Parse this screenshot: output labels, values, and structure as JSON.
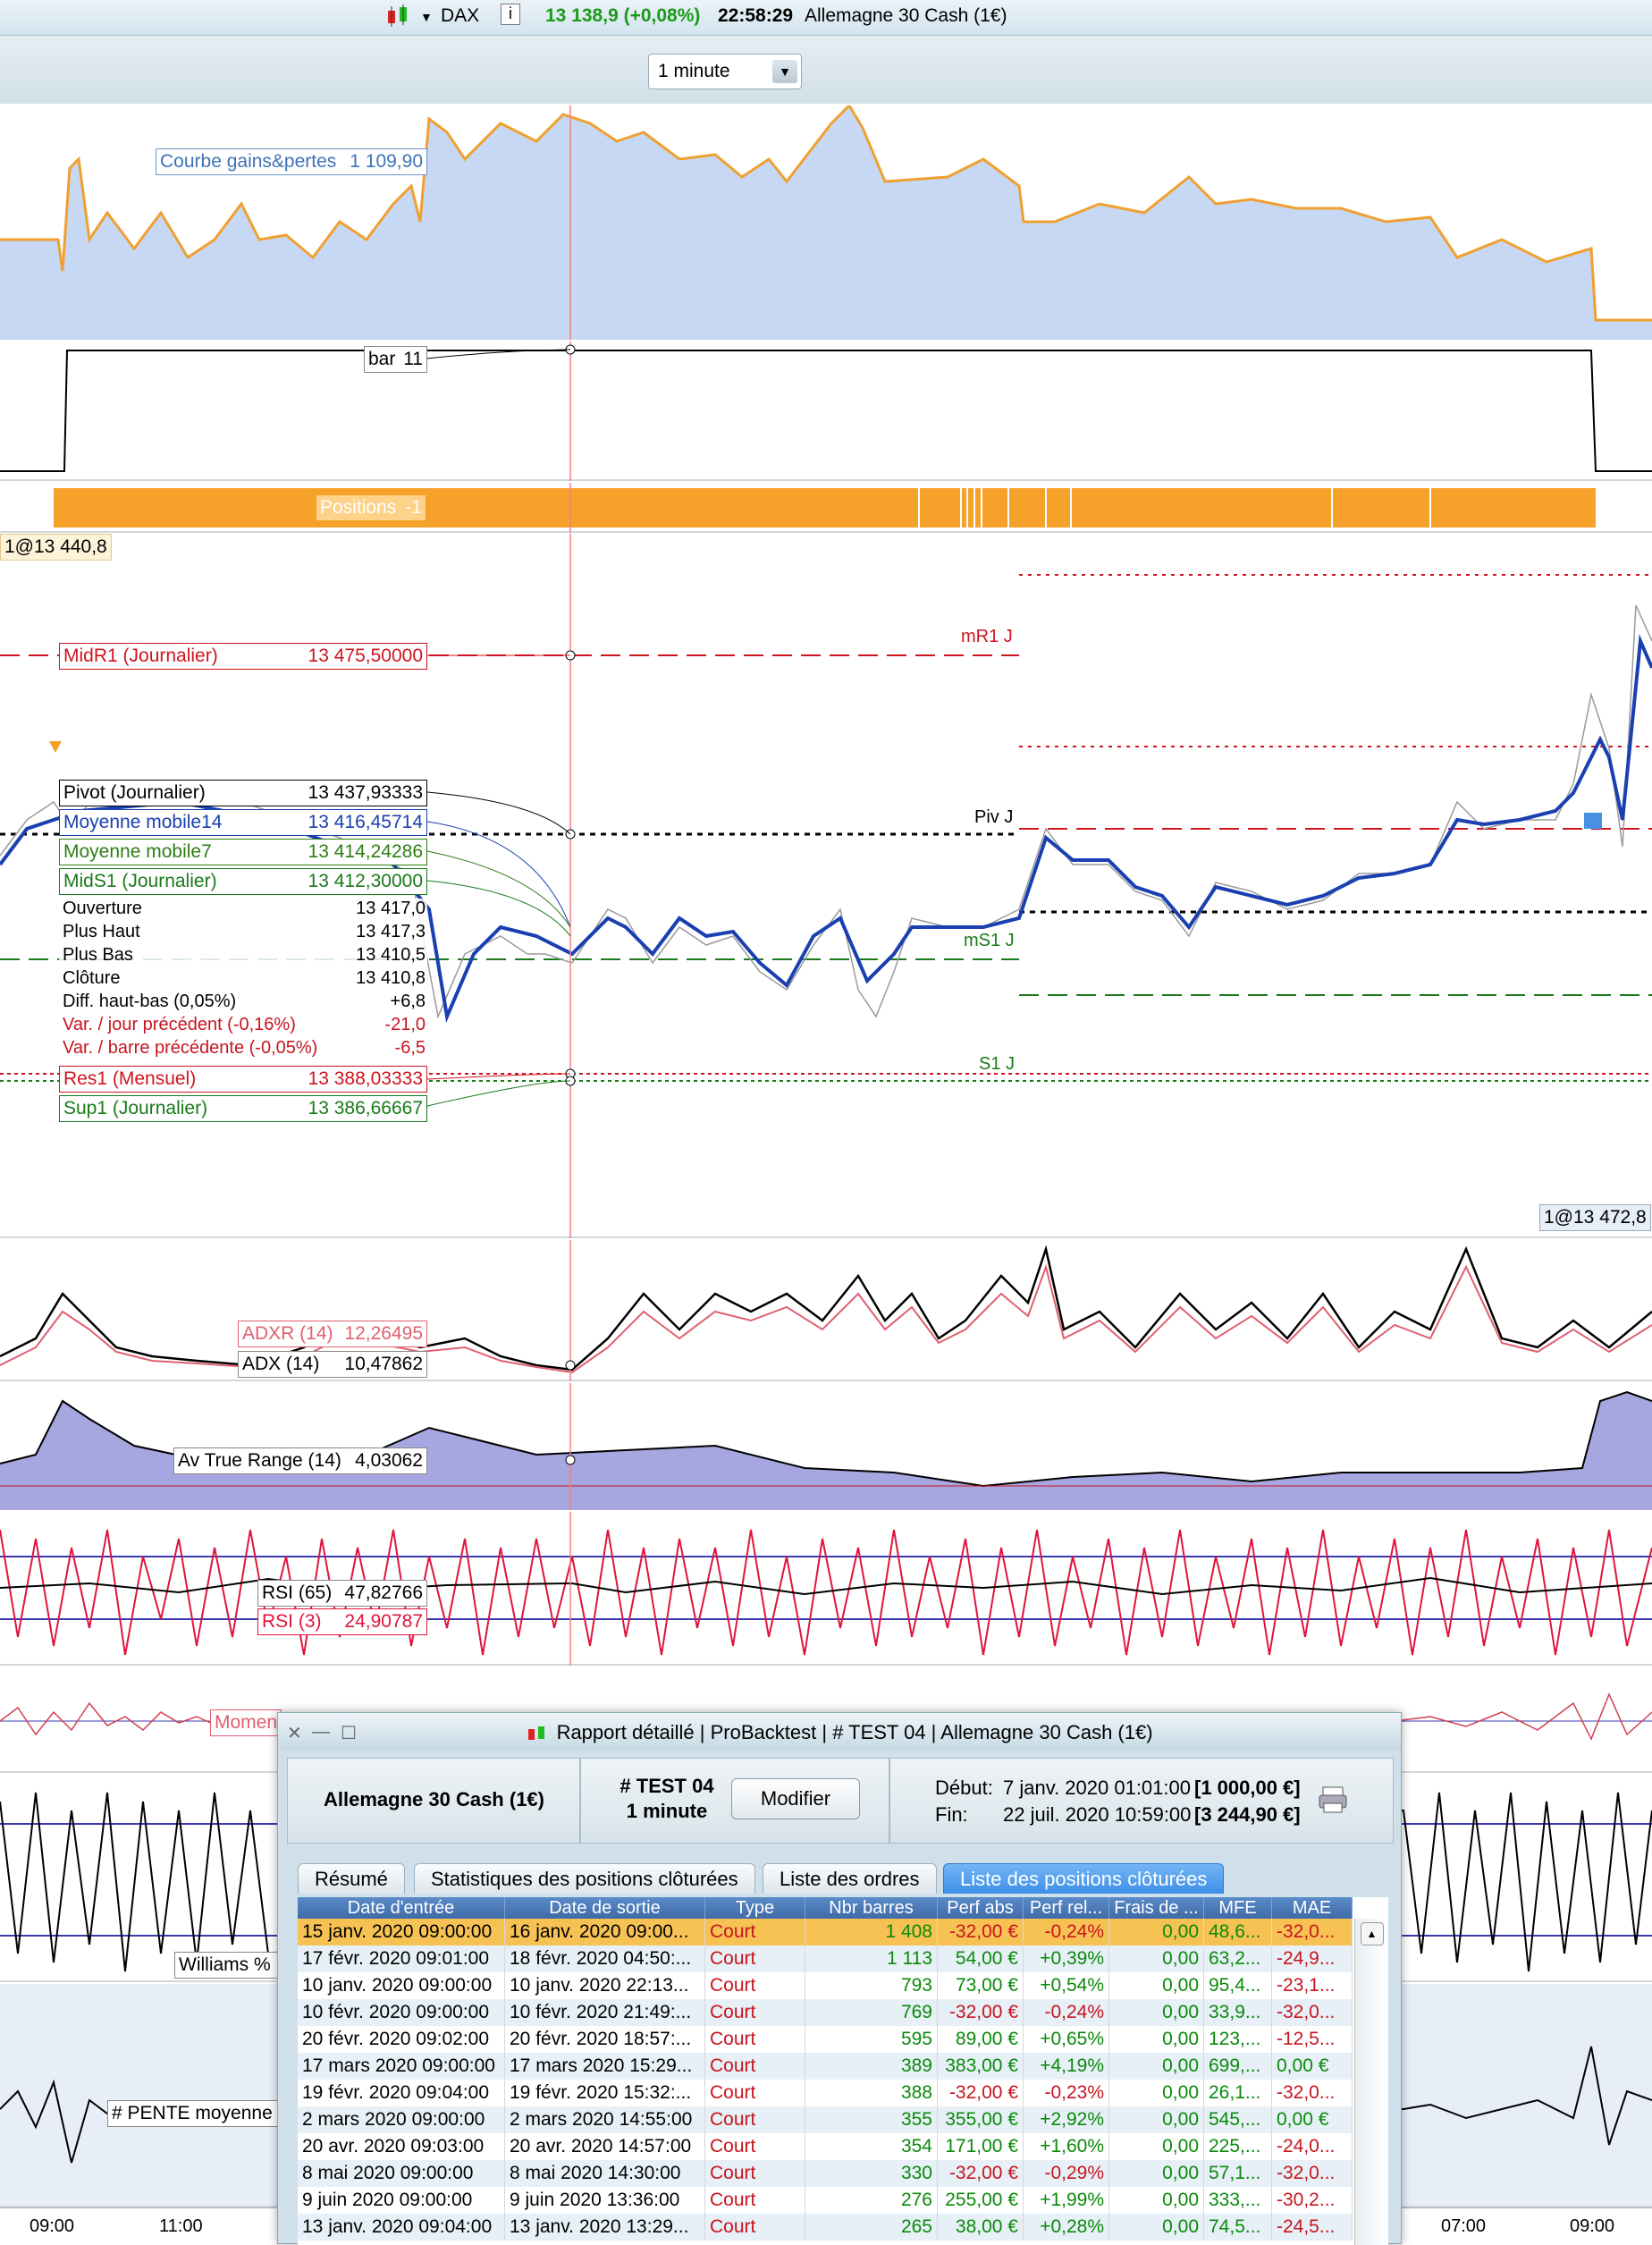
{
  "header": {
    "symbol": "DAX",
    "info_icon": "info-icon",
    "price": "13 138,9 (+0,08%)",
    "time": "22:58:29",
    "instrument": "Allemagne 30 Cash (1€)",
    "price_color": "#1a9a1a"
  },
  "timeframe": {
    "value": "1 minute"
  },
  "equity": {
    "label": "Courbe gains&pertes",
    "value": "1 109,90"
  },
  "bar": {
    "label": "bar",
    "value": "11"
  },
  "positions": {
    "label": "Positions",
    "value": "-1"
  },
  "price": {
    "top_left": "1@13 440,8",
    "bottom_right": "1@13 472,8",
    "line_labels": [
      {
        "name": "mR1 J"
      },
      {
        "name": "Piv J"
      },
      {
        "name": "mS1 J"
      },
      {
        "name": "S1 J"
      }
    ],
    "legend": [
      {
        "label": "MidR1 (Journalier)",
        "value": "13 475,50000",
        "color": "#d0141e"
      },
      {
        "label": "Pivot (Journalier)",
        "value": "13 437,93333",
        "color": "#000000"
      },
      {
        "label": "Moyenne mobile14",
        "value": "13 416,45714",
        "color": "#1a3fb0"
      },
      {
        "label": "Moyenne mobile7",
        "value": "13 414,24286",
        "color": "#2e7d14"
      },
      {
        "label": "MidS1 (Journalier)",
        "value": "13 412,30000",
        "color": "#1a7a1a"
      },
      {
        "label": "Res1 (Mensuel)",
        "value": "13 388,03333",
        "color": "#d0141e"
      },
      {
        "label": "Sup1 (Journalier)",
        "value": "13 386,66667",
        "color": "#1a7a1a"
      }
    ],
    "ohlc": [
      {
        "label": "Ouverture",
        "value": "13 417,0",
        "color": "#000"
      },
      {
        "label": "Plus Haut",
        "value": "13 417,3",
        "color": "#000"
      },
      {
        "label": "Plus Bas",
        "value": "13 410,5",
        "color": "#000"
      },
      {
        "label": "Clôture",
        "value": "13 410,8",
        "color": "#000"
      },
      {
        "label": "Diff. haut-bas (0,05%)",
        "value": "+6,8",
        "color": "#000"
      },
      {
        "label": "Var. / jour précédent (-0,16%)",
        "value": "-21,0",
        "color": "#c8141e"
      },
      {
        "label": "Var. / barre précédente (-0,05%)",
        "value": "-6,5",
        "color": "#c8141e"
      }
    ]
  },
  "adx": {
    "adxr_label": "ADXR (14)",
    "adxr_value": "12,26495",
    "adx_label": "ADX (14)",
    "adx_value": "10,47862"
  },
  "atr": {
    "label": "Av True Range (14)",
    "value": "4,03062"
  },
  "rsi": {
    "rsi65_label": "RSI (65)",
    "rsi65_value": "47,82766",
    "rsi3_label": "RSI (3)",
    "rsi3_value": "24,90787"
  },
  "momentum": {
    "label": "Momen"
  },
  "williams": {
    "label": "Williams %"
  },
  "pente": {
    "label": "# PENTE moyenne"
  },
  "xaxis": {
    "ticks": [
      "09:00",
      "11:00",
      "07:00",
      "09:00"
    ]
  },
  "report": {
    "title_parts": [
      "Rapport détaillé",
      "ProBacktest",
      "# TEST 04",
      "Allemagne 30 Cash (1€)"
    ],
    "instrument": "Allemagne 30 Cash (1€)",
    "test_name": "# TEST 04",
    "test_tf": "1 minute",
    "modify_label": "Modifier",
    "start_label": "Début:",
    "start_date": "7 janv. 2020 01:01:00",
    "start_capital": "[1 000,00 €]",
    "end_label": "Fin:",
    "end_date": "22 juil. 2020 10:59:00",
    "end_capital": "[3 244,90 €]",
    "tabs": [
      "Résumé",
      "Statistiques des positions clôturées",
      "Liste des ordres",
      "Liste des positions clôturées"
    ],
    "columns": [
      "Date d'entrée",
      "Date de sortie",
      "Type",
      "Nbr barres",
      "Perf abs",
      "Perf rel...",
      "Frais de ...",
      "MFE",
      "MAE"
    ],
    "rows": [
      [
        "15 janv. 2020 09:00:00",
        "16 janv. 2020 09:00...",
        "Court",
        "1 408",
        "-32,00 €",
        "-0,24%",
        "0,00",
        "48,6...",
        "-32,0..."
      ],
      [
        "17 févr. 2020 09:01:00",
        "18 févr. 2020 04:50:...",
        "Court",
        "1 113",
        "54,00 €",
        "+0,39%",
        "0,00",
        "63,2...",
        "-24,9..."
      ],
      [
        "10 janv. 2020 09:00:00",
        "10 janv. 2020 22:13...",
        "Court",
        "793",
        "73,00 €",
        "+0,54%",
        "0,00",
        "95,4...",
        "-23,1..."
      ],
      [
        "10 févr. 2020 09:00:00",
        "10 févr. 2020 21:49:...",
        "Court",
        "769",
        "-32,00 €",
        "-0,24%",
        "0,00",
        "33,9...",
        "-32,0..."
      ],
      [
        "20 févr. 2020 09:02:00",
        "20 févr. 2020 18:57:...",
        "Court",
        "595",
        "89,00 €",
        "+0,65%",
        "0,00",
        "123,...",
        "-12,5..."
      ],
      [
        "17 mars 2020 09:00:00",
        "17 mars 2020 15:29...",
        "Court",
        "389",
        "383,00 €",
        "+4,19%",
        "0,00",
        "699,...",
        "0,00 €"
      ],
      [
        "19 févr. 2020 09:04:00",
        "19 févr. 2020 15:32:...",
        "Court",
        "388",
        "-32,00 €",
        "-0,23%",
        "0,00",
        "26,1...",
        "-32,0..."
      ],
      [
        "2 mars 2020 09:00:00",
        "2 mars 2020 14:55:00",
        "Court",
        "355",
        "355,00 €",
        "+2,92%",
        "0,00",
        "545,...",
        "0,00 €"
      ],
      [
        "20 avr. 2020 09:03:00",
        "20 avr. 2020 14:57:00",
        "Court",
        "354",
        "171,00 €",
        "+1,60%",
        "0,00",
        "225,...",
        "-24,0..."
      ],
      [
        "8 mai 2020 09:00:00",
        "8 mai 2020 14:30:00",
        "Court",
        "330",
        "-32,00 €",
        "-0,29%",
        "0,00",
        "57,1...",
        "-32,0..."
      ],
      [
        "9 juin 2020 09:00:00",
        "9 juin 2020 13:36:00",
        "Court",
        "276",
        "255,00 €",
        "+1,99%",
        "0,00",
        "333,...",
        "-30,2..."
      ],
      [
        "13 janv. 2020 09:04:00",
        "13 janv. 2020 13:29...",
        "Court",
        "265",
        "38,00 €",
        "+0,28%",
        "0,00",
        "74,5...",
        "-24,5..."
      ]
    ]
  }
}
